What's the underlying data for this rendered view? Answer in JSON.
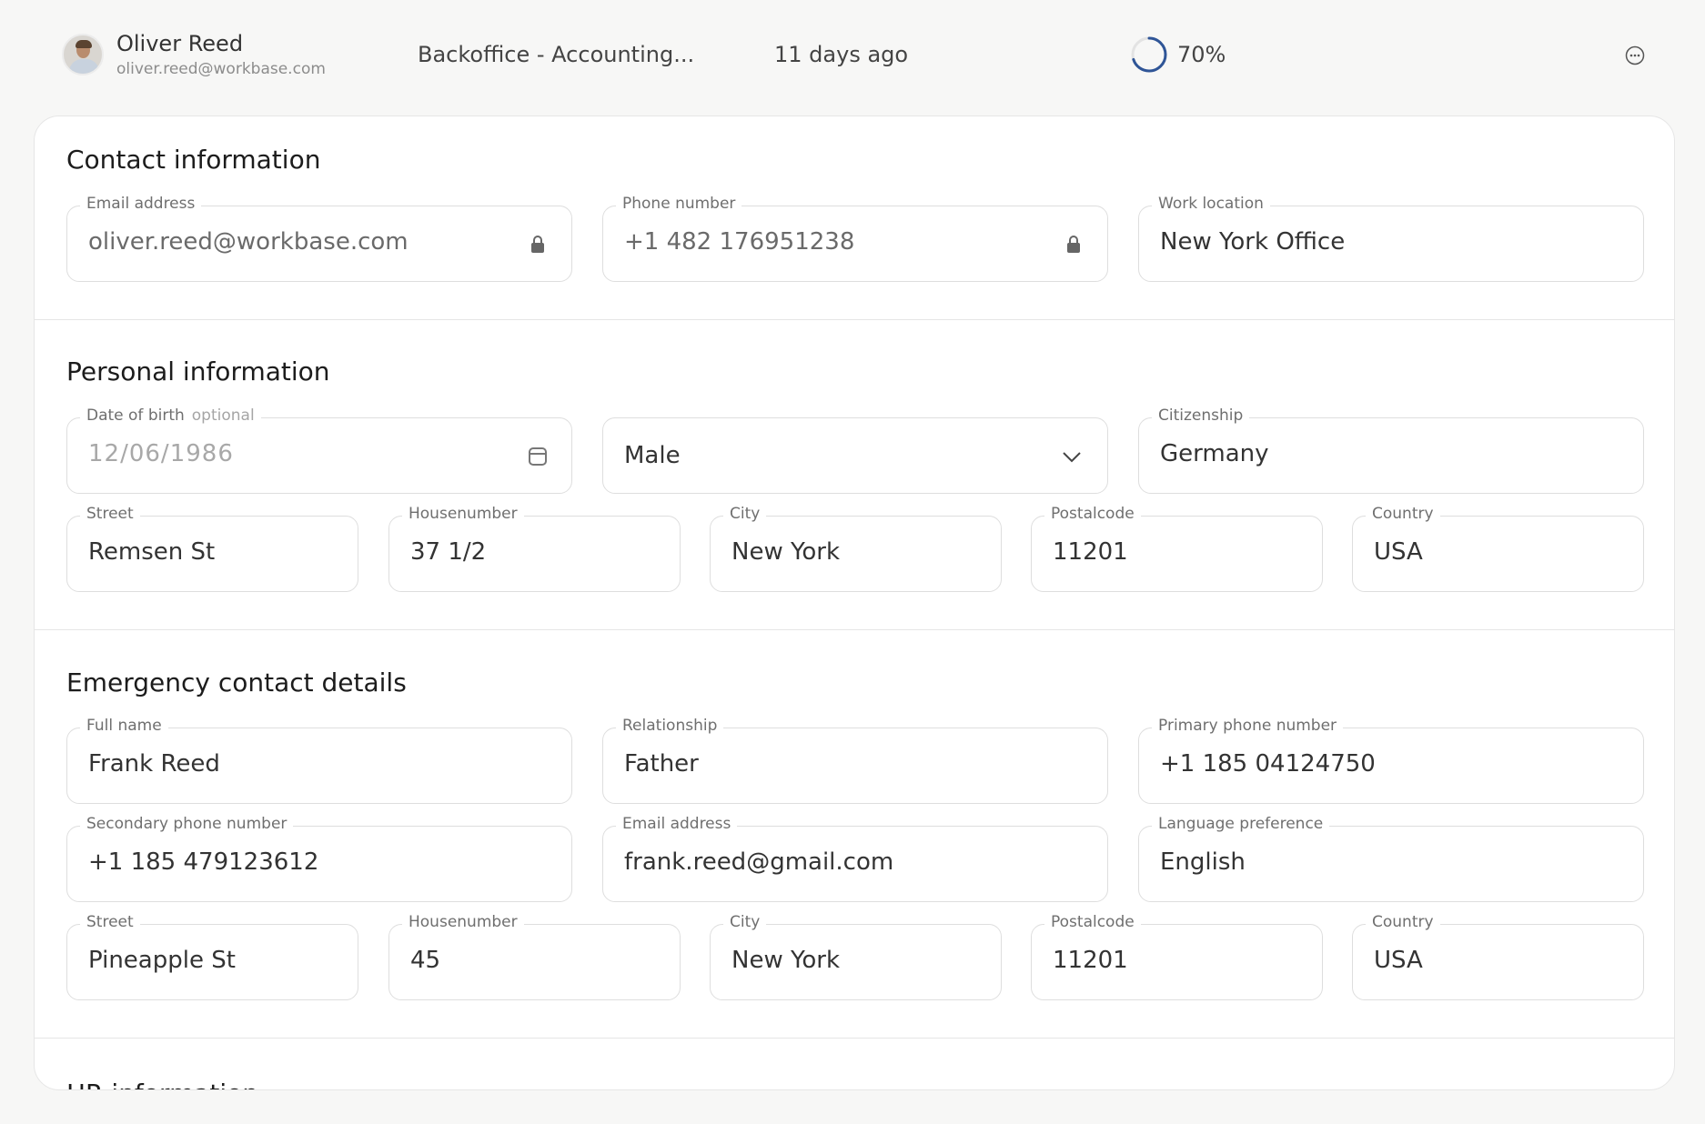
{
  "header": {
    "user_name": "Oliver Reed",
    "user_email": "oliver.reed@workbase.com",
    "project": "Backoffice - Accounting...",
    "updated": "11 days ago",
    "progress_value": 70,
    "progress_label": "70%",
    "accent_color": "#2f5597"
  },
  "contact": {
    "title": "Contact information",
    "email": {
      "label": "Email address",
      "value": "oliver.reed@workbase.com"
    },
    "phone": {
      "label": "Phone number",
      "value": "+1 482 176951238"
    },
    "location": {
      "label": "Work location",
      "value": "New York Office"
    }
  },
  "personal": {
    "title": "Personal information",
    "dob": {
      "label": "Date of birth",
      "optional": "optional",
      "value": "12/06/1986"
    },
    "gender": {
      "value": "Male"
    },
    "citizenship": {
      "label": "Citizenship",
      "value": "Germany"
    },
    "street": {
      "label": "Street",
      "value": "Remsen St"
    },
    "housenumber": {
      "label": "Housenumber",
      "value": "37 1/2"
    },
    "city": {
      "label": "City",
      "value": "New York"
    },
    "postalcode": {
      "label": "Postalcode",
      "value": "11201"
    },
    "country": {
      "label": "Country",
      "value": "USA"
    }
  },
  "emergency": {
    "title": "Emergency contact details",
    "full_name": {
      "label": "Full name",
      "value": "Frank Reed"
    },
    "relationship": {
      "label": "Relationship",
      "value": "Father"
    },
    "primary_phone": {
      "label": "Primary phone number",
      "value": "+1 185 04124750"
    },
    "secondary_phone": {
      "label": "Secondary phone number",
      "value": "+1 185 479123612"
    },
    "email": {
      "label": "Email address",
      "value": "frank.reed@gmail.com"
    },
    "language": {
      "label": "Language preference",
      "value": "English"
    },
    "street": {
      "label": "Street",
      "value": "Pineapple St"
    },
    "housenumber": {
      "label": "Housenumber",
      "value": "45"
    },
    "city": {
      "label": "City",
      "value": "New York"
    },
    "postalcode": {
      "label": "Postalcode",
      "value": "11201"
    },
    "country": {
      "label": "Country",
      "value": "USA"
    }
  },
  "hr": {
    "title": "HR information"
  }
}
